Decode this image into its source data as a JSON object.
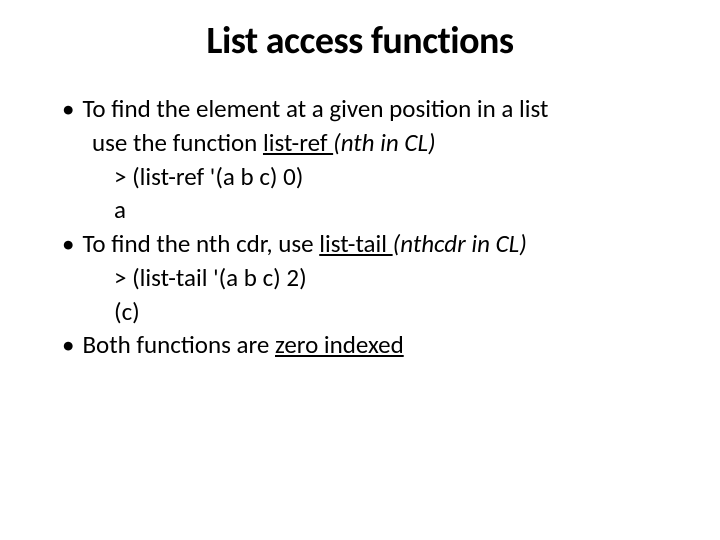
{
  "title": "List access functions",
  "bullet1_line1": "To find the element at a given position in a list",
  "bullet1_line2_pre": "use the function ",
  "bullet1_line2_func": "list-ref ",
  "bullet1_line2_post": "(nth in CL)",
  "b1_code1": "> (list-ref  '(a  b  c) 0)",
  "b1_code2": "a",
  "bullet2_pre": "To find the nth cdr,  use ",
  "bullet2_func": "list-tail ",
  "bullet2_post": "(nthcdr in CL)",
  "b2_code1": "> (list-tail  '(a  b  c) 2)",
  "b2_code2": "(c)",
  "bullet3_pre": "Both functions are ",
  "bullet3_func": "zero indexed"
}
